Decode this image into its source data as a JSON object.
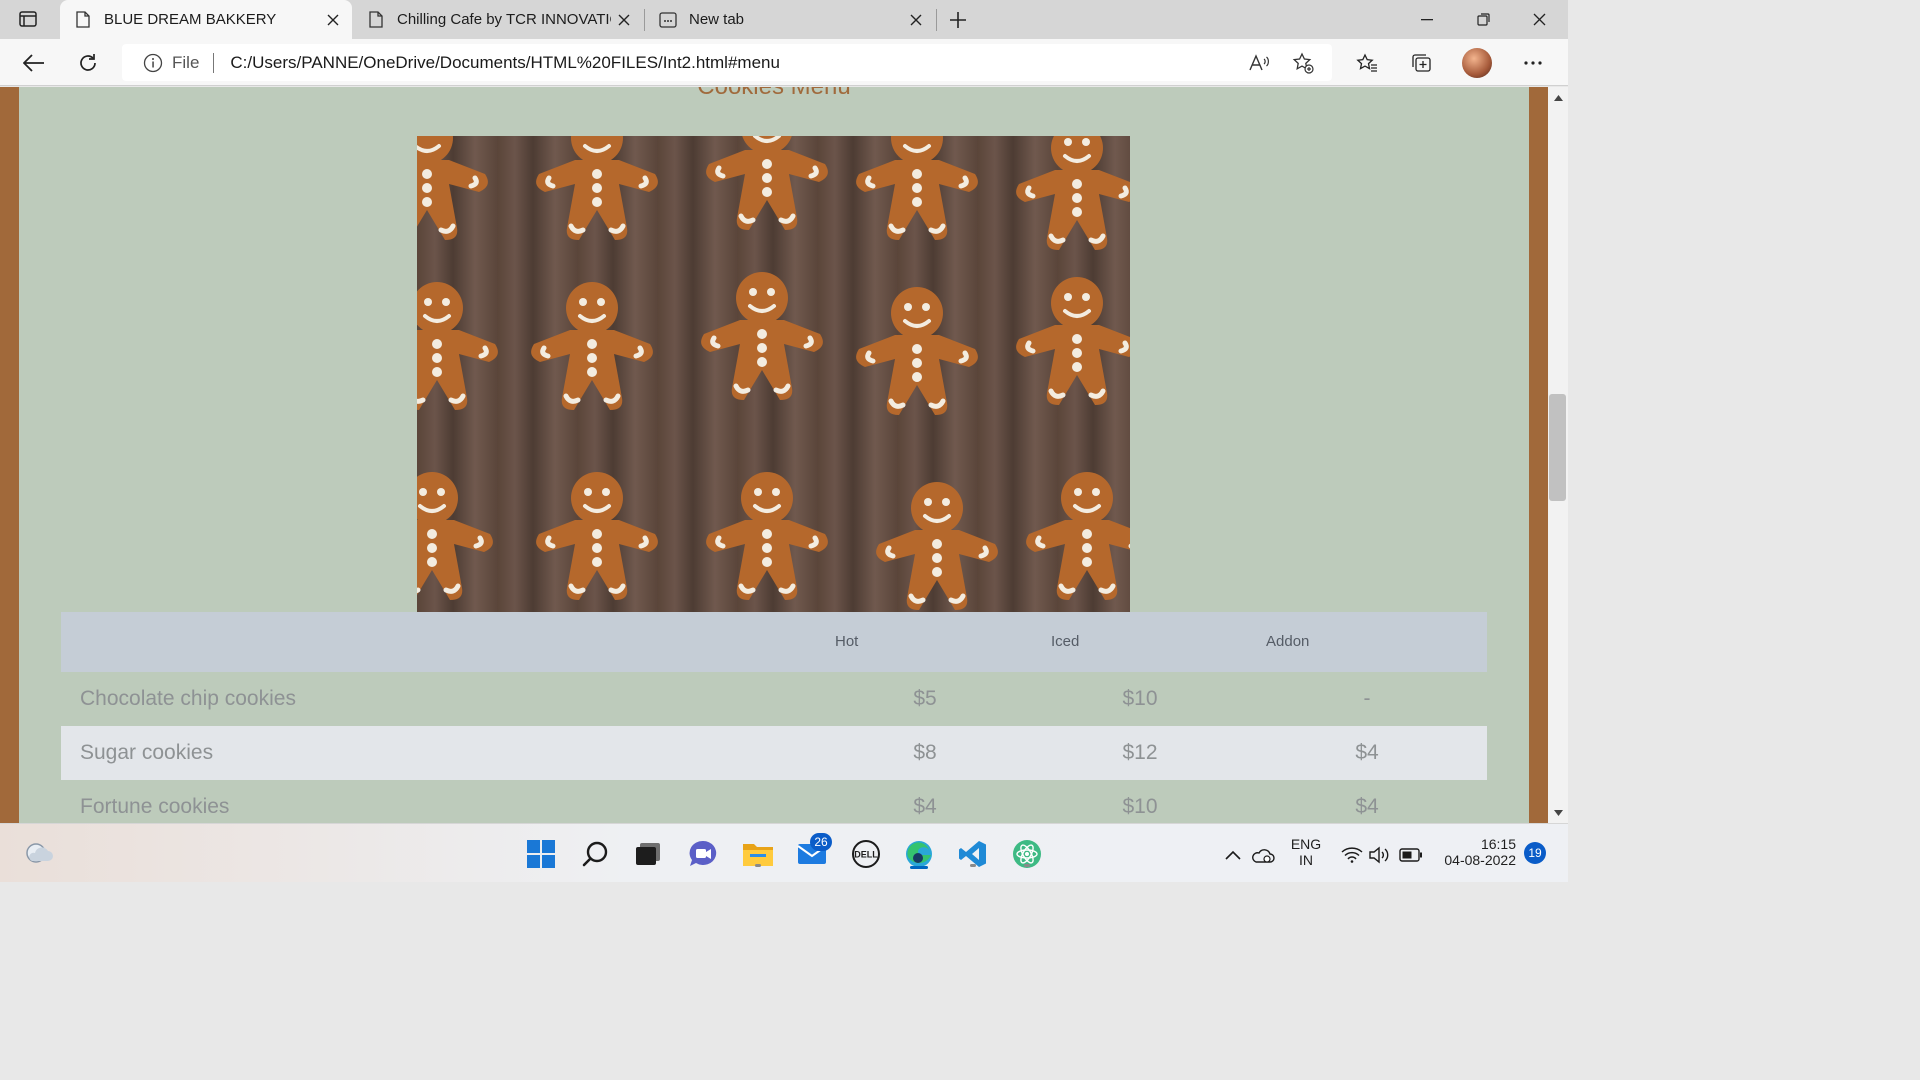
{
  "browser": {
    "tabs": [
      {
        "title": "BLUE DREAM BAKKERY",
        "active": true
      },
      {
        "title": "Chilling Cafe by TCR INNOVATIO",
        "active": false
      },
      {
        "title": "New tab",
        "active": false
      }
    ],
    "address": {
      "scheme": "File",
      "url": "C:/Users/PANNE/OneDrive/Documents/HTML%20FILES/Int2.html#menu"
    }
  },
  "page": {
    "section_title": "Cookies Menu",
    "hero_image_alt": "Gingerbread cookies",
    "table": {
      "headers": [
        "",
        "Hot",
        "Iced",
        "Addon"
      ],
      "rows": [
        {
          "name": "Chocolate chip cookies",
          "hot": "$5",
          "iced": "$10",
          "addon": "-"
        },
        {
          "name": "Sugar cookies",
          "hot": "$8",
          "iced": "$12",
          "addon": "$4"
        },
        {
          "name": "Fortune cookies",
          "hot": "$4",
          "iced": "$10",
          "addon": "$4"
        }
      ]
    },
    "colors": {
      "page_bg": "#bdcbbb",
      "frame": "#a1693a",
      "title": "#a06a3c",
      "table_header": "#c5cdd6",
      "row_alt": "#e3e6ea"
    }
  },
  "taskbar": {
    "mail_badge": "26",
    "language_line1": "ENG",
    "language_line2": "IN",
    "time": "16:15",
    "date": "04-08-2022",
    "notifications": "19",
    "icons": [
      "weather-icon",
      "start-icon",
      "search-icon",
      "task-view-icon",
      "teams-chat-icon",
      "file-explorer-icon",
      "mail-icon",
      "dell-icon",
      "edge-icon",
      "vscode-icon",
      "atom-icon"
    ]
  }
}
